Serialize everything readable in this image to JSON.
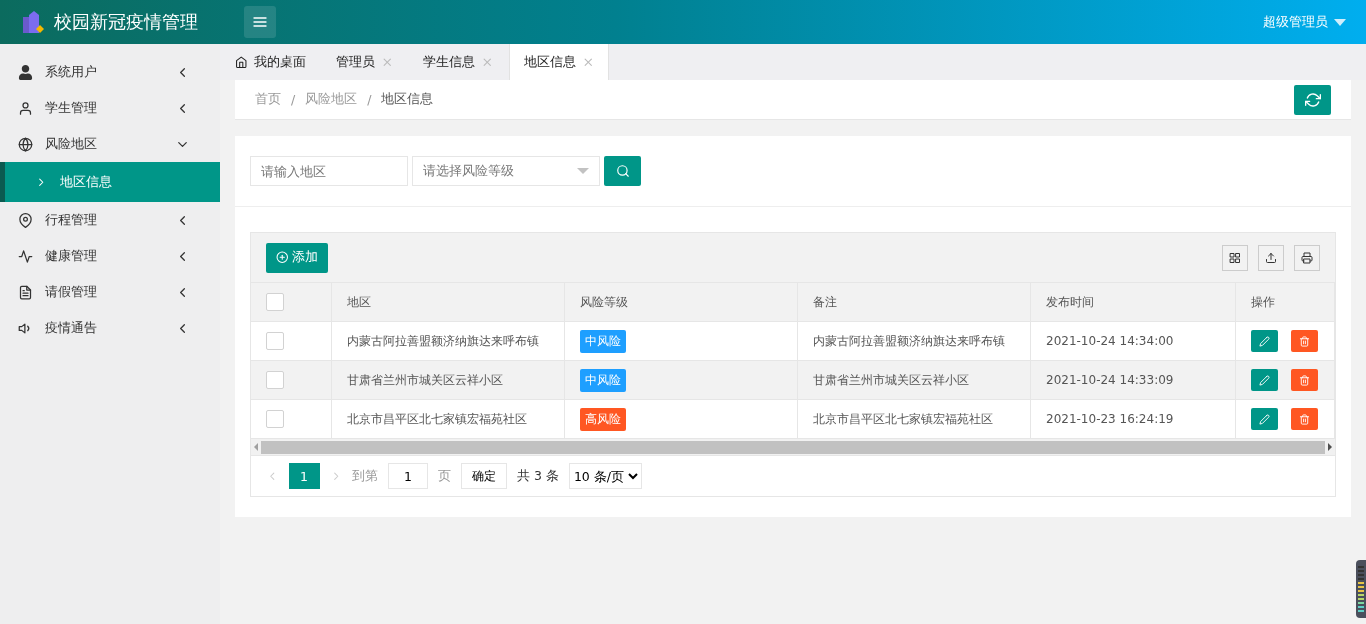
{
  "header": {
    "title": "校园新冠疫情管理",
    "user": "超级管理员"
  },
  "sidebar": {
    "items": [
      {
        "label": "系统用户",
        "expanded": false
      },
      {
        "label": "学生管理",
        "expanded": false
      },
      {
        "label": "风险地区",
        "expanded": true,
        "children": [
          {
            "label": "地区信息",
            "selected": true
          }
        ]
      },
      {
        "label": "行程管理",
        "expanded": false
      },
      {
        "label": "健康管理",
        "expanded": false
      },
      {
        "label": "请假管理",
        "expanded": false
      },
      {
        "label": "疫情通告",
        "expanded": false
      }
    ]
  },
  "tabs": [
    {
      "label": "我的桌面",
      "kind": "home",
      "selected": false
    },
    {
      "label": "管理员",
      "kind": "closable",
      "selected": false
    },
    {
      "label": "学生信息",
      "kind": "closable",
      "selected": false
    },
    {
      "label": "地区信息",
      "kind": "closable",
      "selected": true
    }
  ],
  "breadcrumb": {
    "items": [
      "首页",
      "风险地区",
      "地区信息"
    ],
    "separators": [
      "/",
      "/"
    ]
  },
  "search": {
    "region_placeholder": "请输入地区",
    "level_placeholder": "请选择风险等级"
  },
  "toolbar": {
    "add": "添加"
  },
  "table": {
    "all_checked": false,
    "columns": [
      "地区",
      "风险等级",
      "备注",
      "发布时间",
      "操作"
    ],
    "rows": [
      {
        "checked": false,
        "region": "内蒙古阿拉善盟额济纳旗达来呼布镇",
        "level": "中风险",
        "color": "#1e9fff",
        "note": "内蒙古阿拉善盟额济纳旗达来呼布镇",
        "time": "2021-10-24 14:34:00"
      },
      {
        "checked": false,
        "region": "甘肃省兰州市城关区云祥小区",
        "level": "中风险",
        "color": "#1e9fff",
        "note": "甘肃省兰州市城关区云祥小区",
        "time": "2021-10-24 14:33:09"
      },
      {
        "checked": false,
        "region": "北京市昌平区北七家镇宏福苑社区",
        "level": "高风险",
        "color": "#ff5722",
        "note": "北京市昌平区北七家镇宏福苑社区",
        "time": "2021-10-23 16:24:19"
      }
    ]
  },
  "pager": {
    "current": "1",
    "goto_label": "到第",
    "goto_value": "1",
    "page_unit": "页",
    "confirm": "确定",
    "total": "共 3 条",
    "page_size": "10 条/页"
  }
}
